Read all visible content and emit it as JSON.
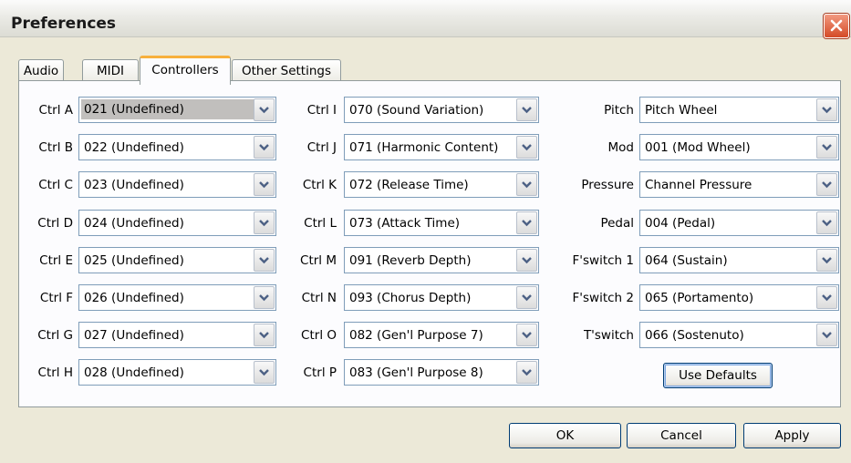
{
  "window": {
    "title": "Preferences"
  },
  "tabs": [
    "Audio",
    "MIDI",
    "Controllers",
    "Other Settings"
  ],
  "col1": [
    {
      "label": "Ctrl A",
      "value": "021 (Undefined)"
    },
    {
      "label": "Ctrl B",
      "value": "022 (Undefined)"
    },
    {
      "label": "Ctrl C",
      "value": "023 (Undefined)"
    },
    {
      "label": "Ctrl D",
      "value": "024 (Undefined)"
    },
    {
      "label": "Ctrl E",
      "value": "025 (Undefined)"
    },
    {
      "label": "Ctrl F",
      "value": "026 (Undefined)"
    },
    {
      "label": "Ctrl G",
      "value": "027 (Undefined)"
    },
    {
      "label": "Ctrl H",
      "value": "028 (Undefined)"
    }
  ],
  "col2": [
    {
      "label": "Ctrl I",
      "value": "070 (Sound Variation)"
    },
    {
      "label": "Ctrl J",
      "value": "071 (Harmonic Content)"
    },
    {
      "label": "Ctrl K",
      "value": "072 (Release Time)"
    },
    {
      "label": "Ctrl L",
      "value": "073 (Attack Time)"
    },
    {
      "label": "Ctrl M",
      "value": "091 (Reverb Depth)"
    },
    {
      "label": "Ctrl N",
      "value": "093 (Chorus Depth)"
    },
    {
      "label": "Ctrl O",
      "value": "082 (Gen'l Purpose 7)"
    },
    {
      "label": "Ctrl P",
      "value": "083 (Gen'l Purpose 8)"
    }
  ],
  "col3": [
    {
      "label": "Pitch",
      "value": "Pitch Wheel"
    },
    {
      "label": "Mod",
      "value": "001 (Mod Wheel)"
    },
    {
      "label": "Pressure",
      "value": "Channel Pressure"
    },
    {
      "label": "Pedal",
      "value": "004 (Pedal)"
    },
    {
      "label": "F'switch 1",
      "value": "064 (Sustain)"
    },
    {
      "label": "F'switch 2",
      "value": "065 (Portamento)"
    },
    {
      "label": "T'switch",
      "value": "066 (Sostenuto)"
    }
  ],
  "use_defaults": "Use Defaults",
  "buttons": {
    "ok": "OK",
    "cancel": "Cancel",
    "apply": "Apply"
  }
}
